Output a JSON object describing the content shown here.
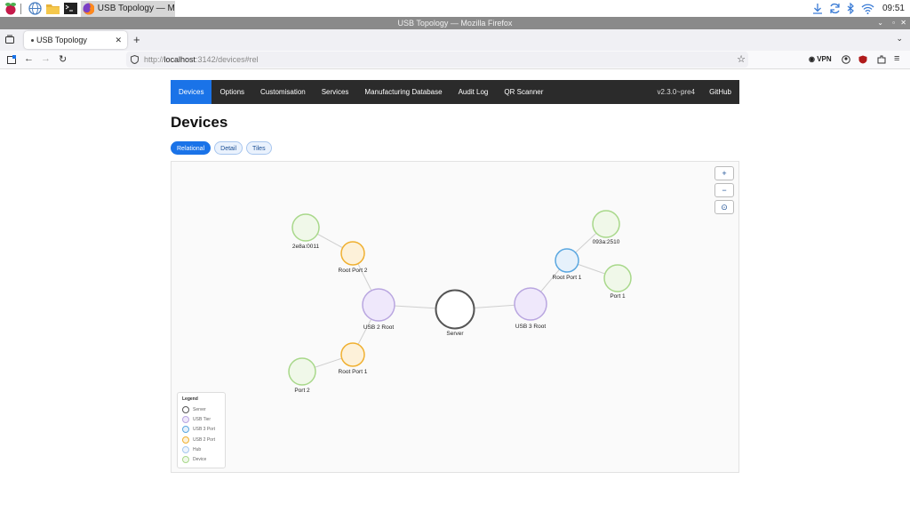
{
  "taskbar": {
    "task_title": "USB Topology — M...",
    "clock": "09:51"
  },
  "window": {
    "title": "USB Topology — Mozilla Firefox"
  },
  "tab": {
    "title": "USB Topology"
  },
  "url": {
    "prefix": "http://",
    "host": "localhost",
    "rest": ":3142/devices#rel",
    "vpn": "VPN"
  },
  "appnav": {
    "items": [
      "Devices",
      "Options",
      "Customisation",
      "Services",
      "Manufacturing Database",
      "Audit Log",
      "QR Scanner"
    ],
    "version": "v2.3.0~pre4",
    "github": "GitHub"
  },
  "page": {
    "title": "Devices",
    "view_tabs": [
      "Relational",
      "Detail",
      "Tiles"
    ]
  },
  "zoom": {
    "in": "+",
    "out": "−",
    "fit": "⊙"
  },
  "graph": {
    "nodes": [
      {
        "id": "server",
        "label": "Server",
        "type": "server"
      },
      {
        "id": "usb2root",
        "label": "USB 2 Root",
        "type": "tier"
      },
      {
        "id": "usb3root",
        "label": "USB 3 Root",
        "type": "tier"
      },
      {
        "id": "rp2",
        "label": "Root Port 2",
        "type": "usb2port"
      },
      {
        "id": "rp1b",
        "label": "Root Port 1",
        "type": "usb2port"
      },
      {
        "id": "rp1a",
        "label": "Root Port 1",
        "type": "usb3port"
      },
      {
        "id": "d2e8a",
        "label": "2e8a:0011",
        "type": "device"
      },
      {
        "id": "port2",
        "label": "Port 2",
        "type": "device"
      },
      {
        "id": "d093a",
        "label": "093a:2510",
        "type": "device"
      },
      {
        "id": "port1",
        "label": "Port 1",
        "type": "device"
      }
    ]
  },
  "legend": {
    "title": "Legend",
    "items": [
      {
        "label": "Server",
        "color": "#555555"
      },
      {
        "label": "USB Tier",
        "color": "#b9a6e0"
      },
      {
        "label": "USB 3 Port",
        "color": "#5aa7e0"
      },
      {
        "label": "USB 2 Port",
        "color": "#f0b030"
      },
      {
        "label": "Hub",
        "color": "#a6c8ee"
      },
      {
        "label": "Device",
        "color": "#a8d88a"
      }
    ]
  },
  "colors": {
    "accent": "#1a73e8",
    "navbar": "#2b2b2b"
  }
}
